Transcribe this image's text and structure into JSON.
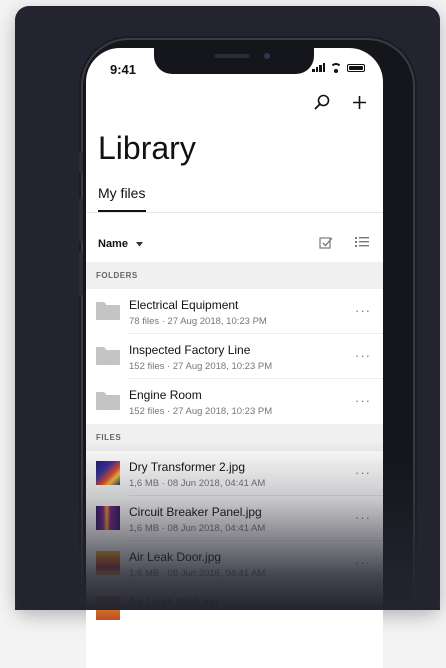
{
  "status": {
    "time": "9:41"
  },
  "header": {
    "title": "Library",
    "search_icon": "search-icon",
    "add_icon": "plus-icon"
  },
  "tabs": [
    {
      "label": "My files",
      "active": true
    }
  ],
  "toolbar": {
    "sort_label": "Name",
    "sort_icon": "chevron-down-icon",
    "select_icon": "checkbox-icon",
    "list_icon": "list-view-icon"
  },
  "sections": {
    "folders": "FOLDERS",
    "files": "FILES"
  },
  "folders": [
    {
      "name": "Electrical Equipment",
      "meta": "78 files · 27 Aug 2018, 10:23 PM"
    },
    {
      "name": "Inspected Factory Line",
      "meta": "152 files · 27 Aug 2018, 10:23 PM"
    },
    {
      "name": "Engine Room",
      "meta": "152 files · 27 Aug 2018, 10:23 PM"
    }
  ],
  "files": [
    {
      "name": "Dry Transformer 2.jpg",
      "meta": "1,6 MB · 08 Jun 2018, 04:41 AM"
    },
    {
      "name": "Circuit Breaker Panel.jpg",
      "meta": "1,6 MB · 08 Jun 2018, 04:41 AM"
    },
    {
      "name": "Air Leak Door.jpg",
      "meta": "1,6 MB · 08 Jun 2018, 04:41 AM"
    },
    {
      "name": "Air Leak Wall.jpg",
      "meta": ""
    }
  ],
  "more_label": "···",
  "colors": {
    "background": "#23242f",
    "screen": "#ffffff",
    "section_bg": "#f0f0f0",
    "folder_icon": "#c4c4c4"
  }
}
